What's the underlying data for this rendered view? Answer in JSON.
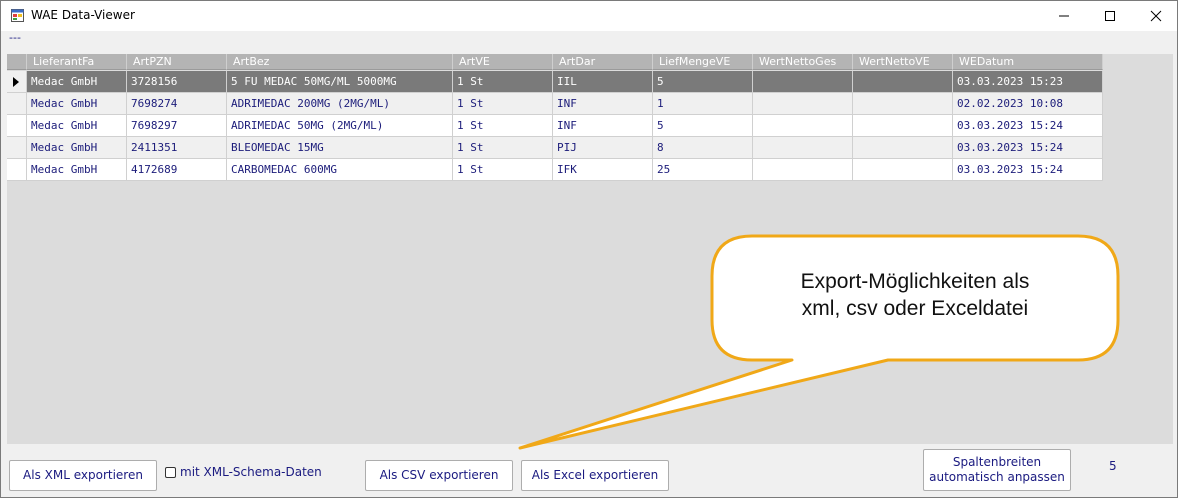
{
  "window": {
    "title": "WAE Data-Viewer",
    "icon": "app-window-icon",
    "controls": [
      "minimize-icon",
      "maximize-icon",
      "close-icon"
    ]
  },
  "menu_strip": {
    "text": "---"
  },
  "grid": {
    "columns": [
      "LieferantFa",
      "ArtPZN",
      "ArtBez",
      "ArtVE",
      "ArtDar",
      "LiefMengeVE",
      "WertNettoGes",
      "WertNettoVE",
      "WEDatum"
    ],
    "rows": [
      [
        "Medac GmbH",
        "3728156",
        "5 FU MEDAC 50MG/ML 5000MG",
        "1 St",
        "IIL",
        "5",
        "",
        "",
        "03.03.2023 15:23"
      ],
      [
        "Medac GmbH",
        "7698274",
        "ADRIMEDAC 200MG (2MG/ML)",
        "1 St",
        "INF",
        "1",
        "",
        "",
        "02.02.2023 10:08"
      ],
      [
        "Medac GmbH",
        "7698297",
        "ADRIMEDAC 50MG (2MG/ML)",
        "1 St",
        "INF",
        "5",
        "",
        "",
        "03.03.2023 15:24"
      ],
      [
        "Medac GmbH",
        "2411351",
        "BLEOMEDAC 15MG",
        "1 St",
        "PIJ",
        "8",
        "",
        "",
        "03.03.2023 15:24"
      ],
      [
        "Medac GmbH",
        "4172689",
        "CARBOMEDAC 600MG",
        "1 St",
        "IFK",
        "25",
        "",
        "",
        "03.03.2023 15:24"
      ]
    ],
    "selected_row_index": 0
  },
  "toolbar": {
    "xml_label": "Als XML exportieren",
    "xml_schema_label": "mit XML-Schema-Daten",
    "xml_schema_checked": false,
    "csv_label": "Als CSV exportieren",
    "excel_label": "Als Excel exportieren",
    "autosize_line1": "Spaltenbreiten",
    "autosize_line2": "automatisch anpassen",
    "row_count": "5"
  },
  "callout": {
    "line1": "Export-Möglichkeiten als",
    "line2": "xml, csv oder Exceldatei"
  },
  "colors": {
    "selected_row": "#7a7a7a",
    "header_bg": "#b4b4b4",
    "text_blue": "#1c1c7a",
    "callout_border": "#f0a818"
  }
}
